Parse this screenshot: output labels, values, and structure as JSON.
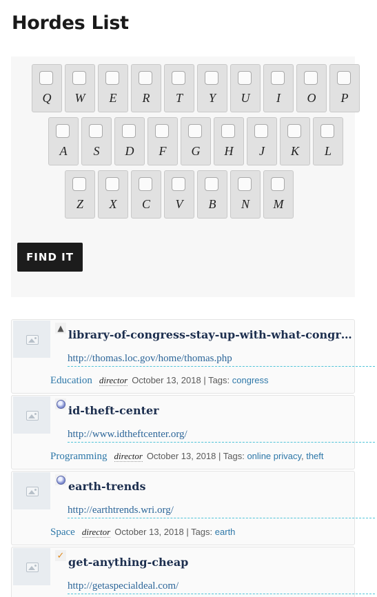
{
  "page": {
    "title": "Hordes List"
  },
  "keyboard": {
    "rows": [
      [
        "Q",
        "W",
        "E",
        "R",
        "T",
        "Y",
        "U",
        "I",
        "O",
        "P"
      ],
      [
        "A",
        "S",
        "D",
        "F",
        "G",
        "H",
        "J",
        "K",
        "L"
      ],
      [
        "Z",
        "X",
        "C",
        "V",
        "B",
        "N",
        "M"
      ]
    ],
    "button_label": "FIND IT"
  },
  "entries": [
    {
      "favicon": "pyramid-icon",
      "title": "library-of-congress-stay-up-with-what-congress-is-doing",
      "url": "http://thomas.loc.gov/home/thomas.php",
      "category": "Education",
      "author": "director",
      "date": "October 13, 2018",
      "tags_label": "Tags:",
      "tags": [
        "congress"
      ]
    },
    {
      "favicon": "globe-icon",
      "title": "id-theft-center",
      "url": "http://www.idtheftcenter.org/",
      "category": "Programming",
      "author": "director",
      "date": "October 13, 2018",
      "tags_label": "Tags:",
      "tags": [
        "online privacy",
        "theft"
      ]
    },
    {
      "favicon": "globe-icon",
      "title": "earth-trends",
      "url": "http://earthtrends.wri.org/",
      "category": "Space",
      "author": "director",
      "date": "October 13, 2018",
      "tags_label": "Tags:",
      "tags": [
        "earth"
      ]
    },
    {
      "favicon": "checkmark-icon",
      "title": "get-anything-cheap",
      "url": "http://getaspecialdeal.com/",
      "category": "",
      "author": "",
      "date": "",
      "tags_label": "",
      "tags": []
    }
  ]
}
